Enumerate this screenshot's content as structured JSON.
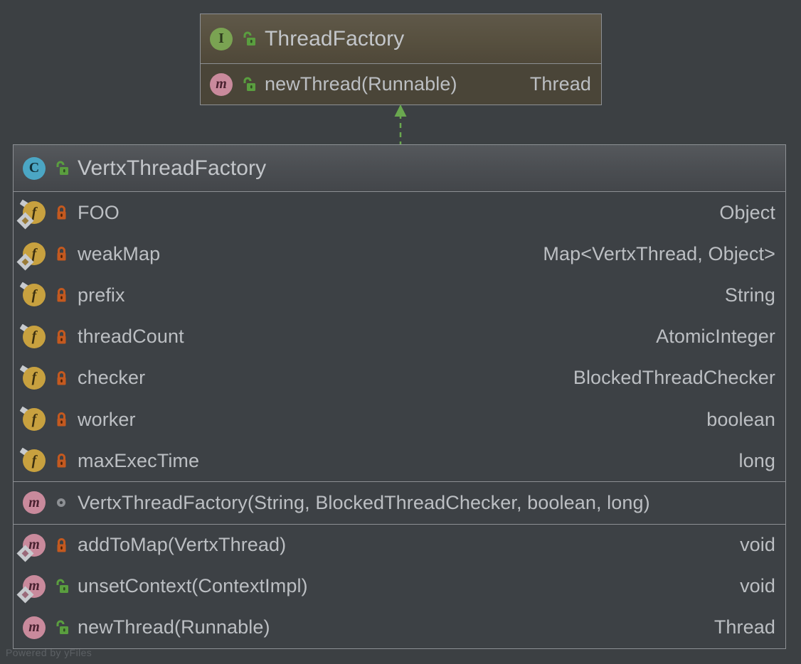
{
  "canvas": {
    "background": "#3c4043",
    "watermark": "Powered by yFiles"
  },
  "colors": {
    "interface_badge": "#7aa352",
    "class_badge": "#4ba6c4",
    "field_badge": "#c8a13f",
    "method_badge": "#c98a9c",
    "public_lock": "#5a9e3f",
    "private_lock": "#c4591f",
    "package_dot": "#8d9094",
    "relation_line": "#6aa84f",
    "text": "#bcbfc3",
    "border": "#8d9094"
  },
  "interface_box": {
    "header": {
      "kind_icon": "interface-icon",
      "visibility_icon": "public-unlocked-icon",
      "name": "ThreadFactory"
    },
    "methods": [
      {
        "kind_icon": "method-icon",
        "visibility_icon": "public-unlocked-icon",
        "signature": "newThread(Runnable)",
        "return_type": "Thread",
        "static": false,
        "final": false
      }
    ]
  },
  "class_box": {
    "header": {
      "kind_icon": "class-icon",
      "visibility_icon": "public-unlocked-icon",
      "name": "VertxThreadFactory"
    },
    "fields": [
      {
        "kind_icon": "field-icon",
        "visibility_icon": "private-locked-icon",
        "name": "FOO",
        "type": "Object",
        "static": true,
        "final": true
      },
      {
        "kind_icon": "field-icon",
        "visibility_icon": "private-locked-icon",
        "name": "weakMap",
        "type": "Map<VertxThread, Object>",
        "static": false,
        "final": true
      },
      {
        "kind_icon": "field-icon",
        "visibility_icon": "private-locked-icon",
        "name": "prefix",
        "type": "String",
        "static": true,
        "final": false
      },
      {
        "kind_icon": "field-icon",
        "visibility_icon": "private-locked-icon",
        "name": "threadCount",
        "type": "AtomicInteger",
        "static": true,
        "final": false
      },
      {
        "kind_icon": "field-icon",
        "visibility_icon": "private-locked-icon",
        "name": "checker",
        "type": "BlockedThreadChecker",
        "static": true,
        "final": false
      },
      {
        "kind_icon": "field-icon",
        "visibility_icon": "private-locked-icon",
        "name": "worker",
        "type": "boolean",
        "static": true,
        "final": false
      },
      {
        "kind_icon": "field-icon",
        "visibility_icon": "private-locked-icon",
        "name": "maxExecTime",
        "type": "long",
        "static": true,
        "final": false
      }
    ],
    "constructors": [
      {
        "kind_icon": "method-icon",
        "visibility_icon": "package-private-icon",
        "signature": "VertxThreadFactory(String, BlockedThreadChecker, boolean, long)",
        "return_type": "",
        "static": false,
        "final": false
      }
    ],
    "methods": [
      {
        "kind_icon": "method-icon",
        "visibility_icon": "private-locked-icon",
        "signature": "addToMap(VertxThread)",
        "return_type": "void",
        "static": false,
        "final": true
      },
      {
        "kind_icon": "method-icon",
        "visibility_icon": "public-unlocked-icon",
        "signature": "unsetContext(ContextImpl)",
        "return_type": "void",
        "static": false,
        "final": true
      },
      {
        "kind_icon": "method-icon",
        "visibility_icon": "public-unlocked-icon",
        "signature": "newThread(Runnable)",
        "return_type": "Thread",
        "static": false,
        "final": false
      }
    ]
  },
  "relation": {
    "type": "realization",
    "style": "dashed",
    "arrowhead": "solid-triangle",
    "from": "VertxThreadFactory",
    "to": "ThreadFactory"
  }
}
